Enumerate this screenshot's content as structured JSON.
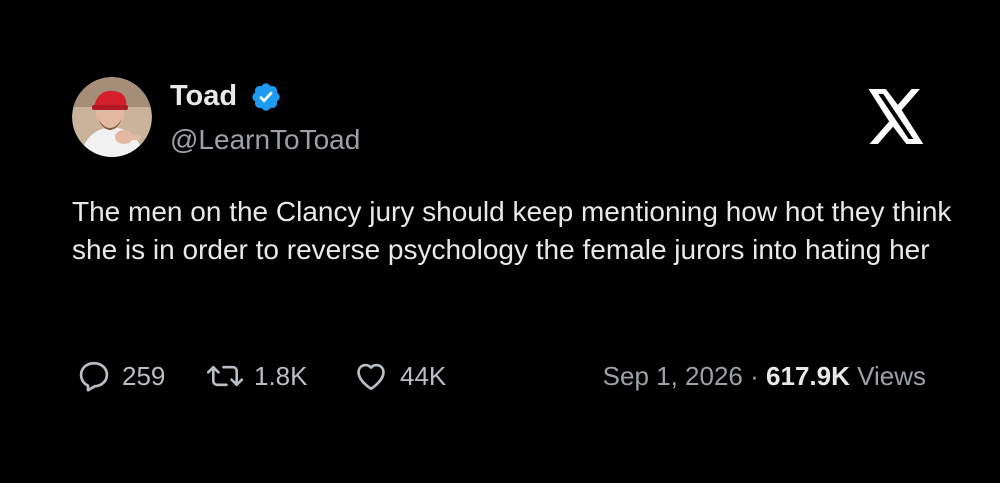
{
  "author": {
    "display_name": "Toad",
    "handle": "@LearnToToad",
    "verified": true,
    "avatar_icon": "avatar-photo"
  },
  "brand": {
    "logo_icon": "x-logo-icon"
  },
  "tweet": {
    "text": "The men on the Clancy jury should keep mentioning how hot they think she is in order to reverse psychology the female jurors into hating her"
  },
  "stats": {
    "replies": "259",
    "reposts": "1.8K",
    "likes": "44K"
  },
  "meta": {
    "date": "Sep 1, 2026",
    "separator": "·",
    "views_count": "617.9K",
    "views_label": "Views"
  },
  "colors": {
    "background": "#000000",
    "text_primary": "#e7e9ea",
    "text_secondary": "#9aa1a7",
    "verified_blue": "#1d9bf0"
  }
}
